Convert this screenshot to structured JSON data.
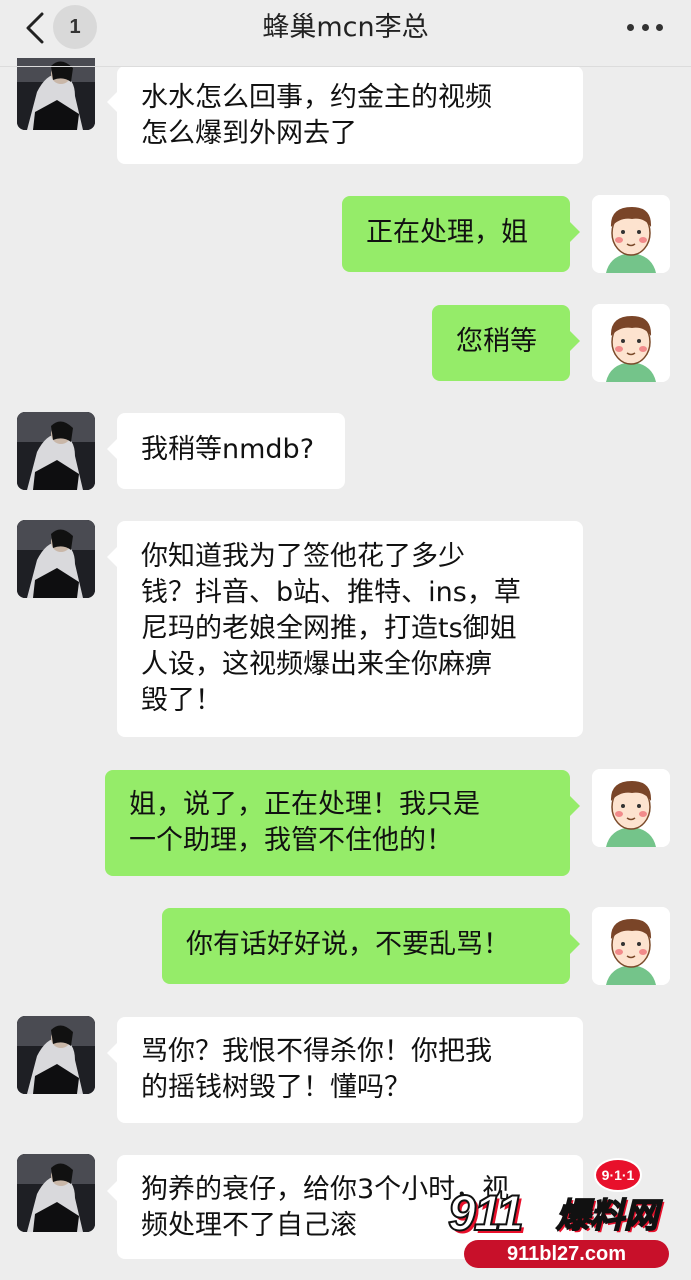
{
  "header": {
    "title": "蜂巢mcn李总",
    "unread_count": "1"
  },
  "messages": [
    {
      "sender": "contact",
      "lines": [
        "水水怎么回事，约金主的视频",
        "怎么爆到外网去了"
      ]
    },
    {
      "sender": "me",
      "lines": [
        "正在处理，姐"
      ]
    },
    {
      "sender": "me",
      "lines": [
        "您稍等"
      ]
    },
    {
      "sender": "contact",
      "lines": [
        "我稍等nmdb?"
      ]
    },
    {
      "sender": "contact",
      "lines": [
        "你知道我为了签他花了多少",
        "钱？抖音、b站、推特、ins，草",
        "尼玛的老娘全网推，打造ts御姐",
        "人设，这视频爆出来全你麻痹",
        "毁了！"
      ]
    },
    {
      "sender": "me",
      "lines": [
        "姐，说了，正在处理！我只是",
        "一个助理，我管不住他的！"
      ]
    },
    {
      "sender": "me",
      "lines": [
        "你有话好好说，不要乱骂！"
      ]
    },
    {
      "sender": "contact",
      "lines": [
        "骂你？我恨不得杀你！你把我",
        "的摇钱树毁了！懂吗？"
      ]
    },
    {
      "sender": "contact",
      "lines": [
        "狗养的衰仔，给你3个小时，视",
        "频处理不了自己滚"
      ]
    }
  ],
  "watermark": {
    "logo_number": "911",
    "logo_chars": "爆料网",
    "badge": "9·1·1",
    "url": "911bl27.com"
  },
  "colors": {
    "background": "#ededed",
    "incoming_bubble": "#ffffff",
    "outgoing_bubble": "#95ec69",
    "watermark_red": "#e8102b"
  }
}
